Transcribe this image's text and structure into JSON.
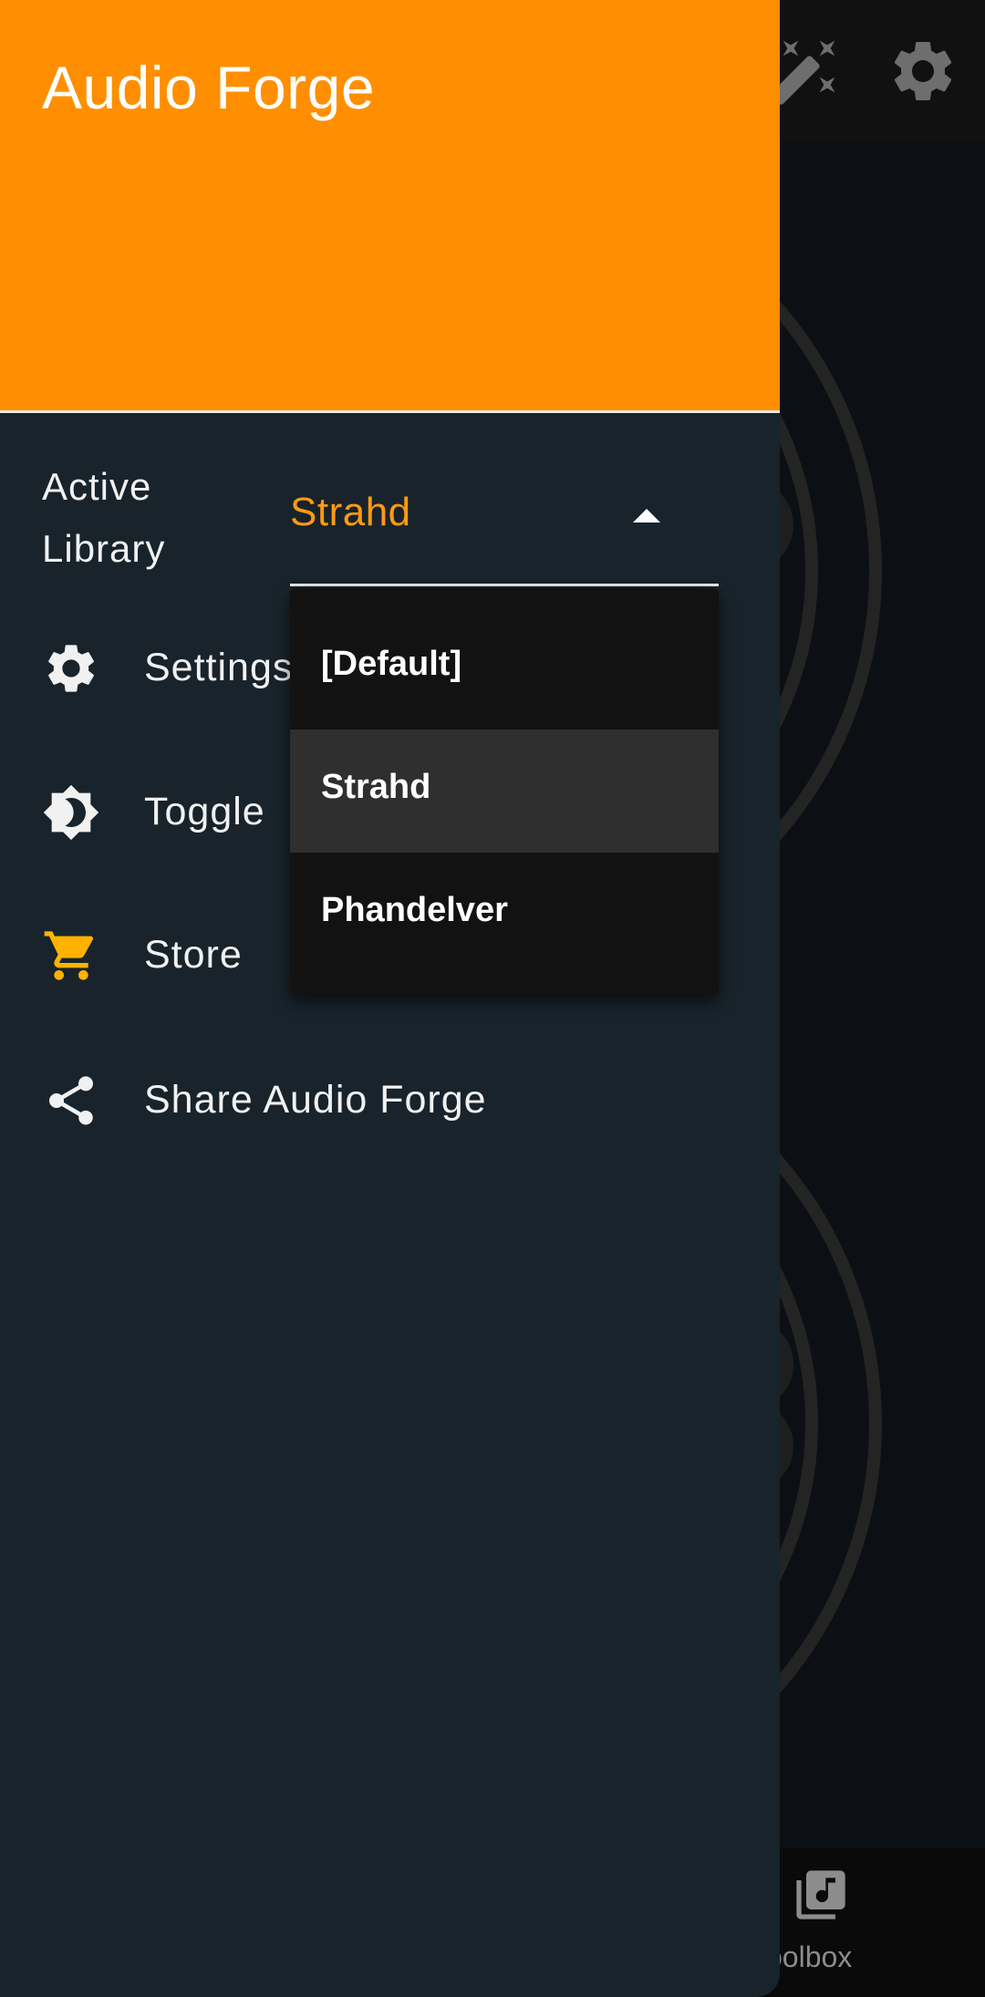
{
  "app": {
    "title": "Audio Forge"
  },
  "colors": {
    "accent": "#ff8f00",
    "drawer_bg": "#18232b",
    "selected_value": "#ff9a14"
  },
  "drawer": {
    "library": {
      "label": "Active Library",
      "selected_value": "Strahd",
      "options": [
        "[Default]",
        "Strahd",
        "Phandelver"
      ],
      "expanded": true
    },
    "menu_items": [
      {
        "label": "Settings",
        "icon": "gear-icon"
      },
      {
        "label": "Toggle",
        "icon": "brightness-icon"
      },
      {
        "label": "Store",
        "icon": "cart-icon"
      },
      {
        "label": "Share Audio Forge",
        "icon": "share-icon"
      }
    ]
  },
  "background": {
    "appbar_icons": [
      "magic-wand-icon",
      "gear-icon"
    ],
    "bottom_nav": {
      "label": "oolbox",
      "icon": "music-library-icon"
    }
  }
}
